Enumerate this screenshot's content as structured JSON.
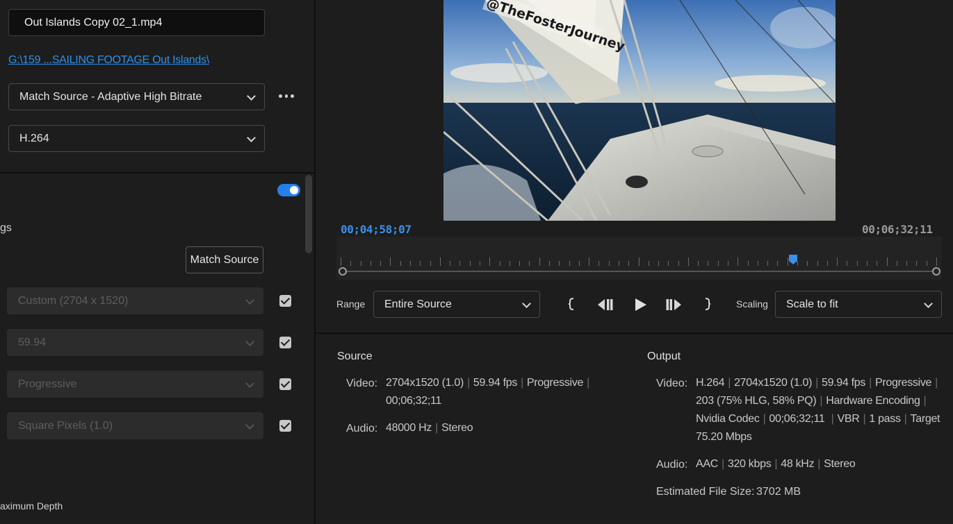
{
  "export": {
    "filename": "Out Islands Copy 02_1.mp4",
    "path": "G:\\159 ...SAILING FOOTAGE Out Islands\\",
    "preset": "Match Source - Adaptive High Bitrate",
    "format": "H.264"
  },
  "video_settings": {
    "section_fragment": "gs",
    "match_source_label": "Match Source",
    "frame_size": "Custom (2704 x 1520)",
    "frame_rate": "59.94",
    "field_order": "Progressive",
    "aspect": "Square Pixels (1.0)",
    "depth_fragment": "aximum Depth",
    "toggle_on": true
  },
  "preview": {
    "watermark": "@TheFosterJourney",
    "timecode_current": "00;04;58;07",
    "timecode_total": "00;06;32;11",
    "playhead_fraction": 0.759
  },
  "controls": {
    "range_label": "Range",
    "range_value": "Entire Source",
    "scaling_label": "Scaling",
    "scaling_value": "Scale to fit",
    "icons": [
      "mark-in-icon",
      "step-back-icon",
      "play-icon",
      "step-forward-icon",
      "mark-out-icon"
    ]
  },
  "source": {
    "heading": "Source",
    "video_label": "Video:",
    "video_line1": [
      "2704x1520 (1.0)",
      "59.94 fps",
      "Progressive"
    ],
    "video_line2": "00;06;32;11",
    "audio_label": "Audio:",
    "audio_line": [
      "48000 Hz",
      "Stereo"
    ]
  },
  "output": {
    "heading": "Output",
    "video_label": "Video:",
    "video_line1": [
      "H.264",
      "2704x1520 (1.0)",
      "59.94 fps",
      "Progressive"
    ],
    "video_line2": [
      "203 (75% HLG, 58% PQ)",
      "Hardware Encoding"
    ],
    "video_line3": [
      "Nvidia Codec",
      "00;06;32;11 ",
      "VBR",
      "1 pass",
      "Target"
    ],
    "video_line4": "75.20 Mbps",
    "audio_label": "Audio:",
    "audio_line": [
      "AAC",
      "320 kbps",
      "48 kHz",
      "Stereo"
    ],
    "filesize_label": "Estimated File Size:",
    "filesize_value": "3702 MB"
  },
  "colors": {
    "accent": "#2680eb",
    "timecode": "#3b8fe8",
    "panel_bg": "#1d1d1d"
  }
}
